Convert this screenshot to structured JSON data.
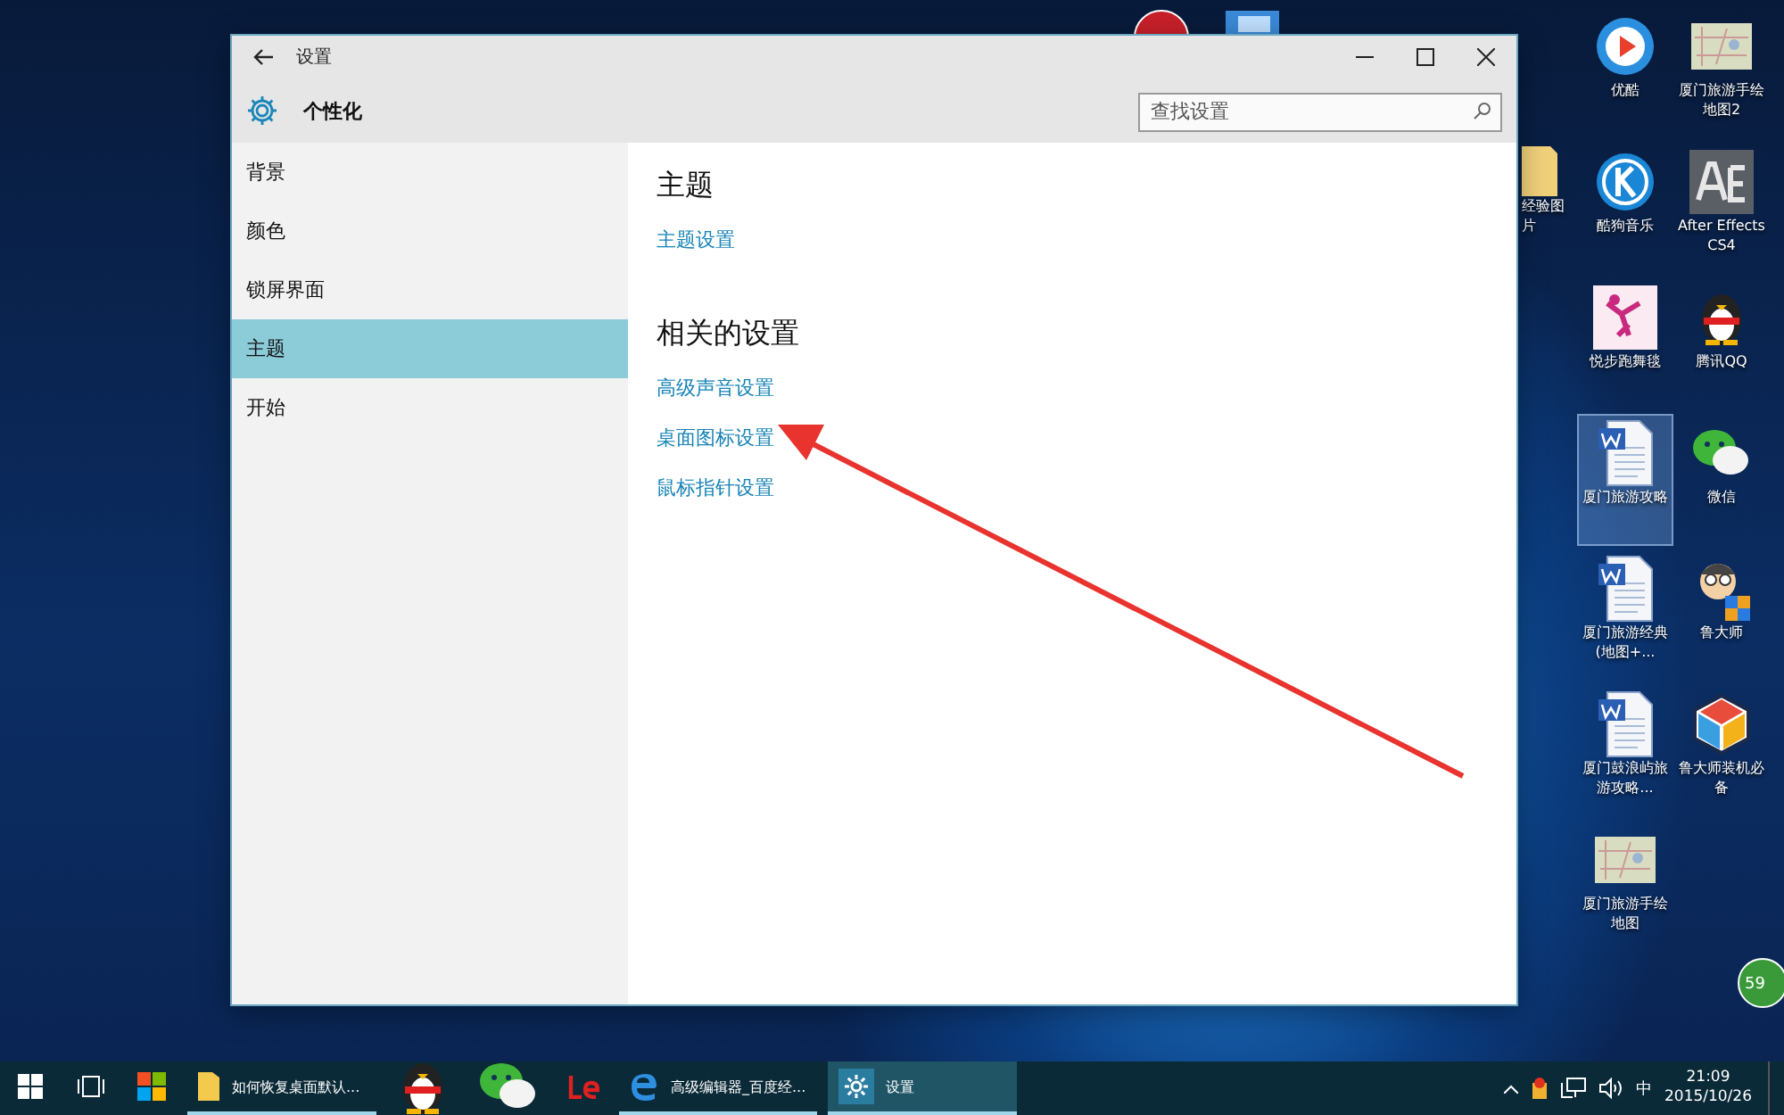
{
  "window": {
    "title": "设置",
    "page": "个性化",
    "search": {
      "placeholder": "查找设置"
    }
  },
  "sidebar": {
    "items": [
      {
        "label": "背景",
        "selected": false
      },
      {
        "label": "颜色",
        "selected": false
      },
      {
        "label": "锁屏界面",
        "selected": false
      },
      {
        "label": "主题",
        "selected": true
      },
      {
        "label": "开始",
        "selected": false
      }
    ]
  },
  "content": {
    "sections": [
      {
        "heading": "主题",
        "links": [
          "主题设置"
        ]
      },
      {
        "heading": "相关的设置",
        "links": [
          "高级声音设置",
          "桌面图标设置",
          "鼠标指针设置"
        ]
      }
    ]
  },
  "desktop": {
    "partial_icon_label": "经验图片",
    "badge": "59",
    "icons": [
      {
        "kind": "player",
        "label": "优酷",
        "selected": false
      },
      {
        "kind": "map",
        "label": "厦门旅游手绘地图2",
        "selected": false
      },
      {
        "kind": "music",
        "label": "酷狗音乐",
        "selected": false
      },
      {
        "kind": "ae",
        "label": "After Effects CS4",
        "selected": false
      },
      {
        "kind": "dance",
        "label": "悦步跑舞毯",
        "selected": false
      },
      {
        "kind": "penguin",
        "label": "腾讯QQ",
        "selected": false
      },
      {
        "kind": "doc",
        "label": "厦门旅游攻略",
        "selected": true
      },
      {
        "kind": "chat",
        "label": "微信",
        "selected": false
      },
      {
        "kind": "doc",
        "label": "厦门旅游经典(地图+...",
        "selected": false
      },
      {
        "kind": "mascot",
        "label": "鲁大师",
        "selected": false
      },
      {
        "kind": "doc",
        "label": "厦门鼓浪屿旅游攻略...",
        "selected": false
      },
      {
        "kind": "box",
        "label": "鲁大师装机必备",
        "selected": false
      },
      {
        "kind": "map",
        "label": "厦门旅游手绘地图",
        "selected": false
      }
    ]
  },
  "taskbar": {
    "buttons": [
      {
        "kind": "start",
        "running": false,
        "active": false
      },
      {
        "kind": "taskview",
        "running": false,
        "active": false
      },
      {
        "kind": "tiles",
        "running": false,
        "active": false
      },
      {
        "kind": "folder",
        "label": "如何恢复桌面默认...",
        "running": true,
        "active": false
      },
      {
        "kind": "penguin",
        "running": false,
        "active": false
      },
      {
        "kind": "chat",
        "running": false,
        "active": false
      },
      {
        "kind": "le",
        "running": false,
        "active": false
      },
      {
        "kind": "edge",
        "label": "高级编辑器_百度经...",
        "running": true,
        "active": false
      },
      {
        "kind": "gear",
        "label": "设置",
        "running": true,
        "active": true
      }
    ],
    "tray": {
      "input_method": "中",
      "time": "21:09",
      "date": "2015/10/26"
    }
  }
}
